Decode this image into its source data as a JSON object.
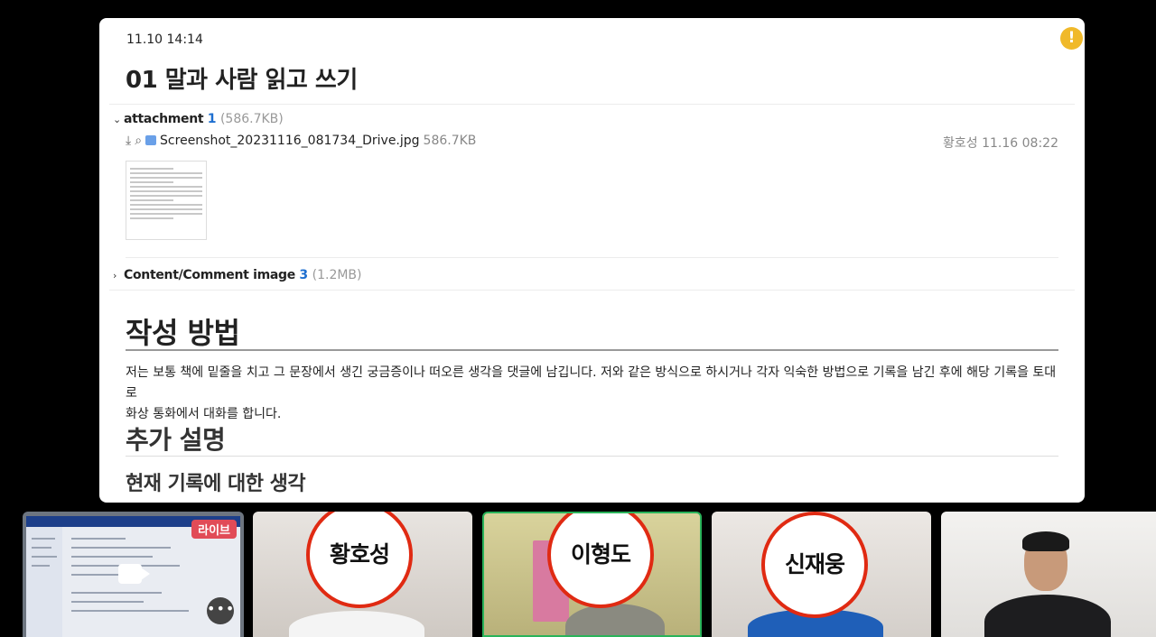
{
  "doc": {
    "timestamp": "11.10 14:14",
    "title": "01 말과 사람 읽고 쓰기",
    "attachment": {
      "label": "attachment",
      "count": "1",
      "size": "(586.7KB)",
      "file": {
        "name": "Screenshot_20231116_081734_Drive.jpg",
        "size": "586.7KB",
        "uploader": "황호성 11.16 08:22"
      }
    },
    "content_images": {
      "label": "Content/Comment image",
      "count": "3",
      "size": "(1.2MB)"
    },
    "heading1": "작성 방법",
    "paragraph_line1": "저는 보통 책에 밑줄을 치고 그 문장에서 생긴 궁금증이나 떠오른 생각을 댓글에 남깁니다. 저와 같은 방식으로 하시거나 각자 익숙한 방법으로 기록을 남긴 후에 해당 기록을 토대로",
    "paragraph_line2": "화상 통화에서 대화를 합니다.",
    "heading2": "추가 설명",
    "heading3": "현재 기록에 대한 생각"
  },
  "participants": {
    "live_badge": "라이브",
    "names": [
      "황호성",
      "이형도",
      "신재웅"
    ]
  },
  "colors": {
    "accent_blue": "#1e6fd0",
    "alert_yellow": "#f0b92a",
    "live_red": "#e14b57",
    "active_speaker_green": "#2ab35a"
  }
}
